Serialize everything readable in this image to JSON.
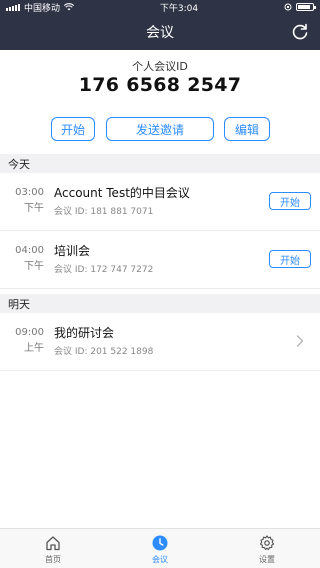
{
  "status_bar": {
    "carrier": "中国移动",
    "time": "下午3:04"
  },
  "nav": {
    "title": "会议",
    "refresh_icon": "refresh-icon"
  },
  "personal_meeting": {
    "label": "个人会议ID",
    "id": "176 6568 2547",
    "start_label": "开始",
    "invite_label": "发送邀请",
    "edit_label": "编辑"
  },
  "sections": [
    {
      "header": "今天",
      "meetings": [
        {
          "time": "03:00",
          "period": "下午",
          "topic": "Account Test的中目会议",
          "meeting_id": "会议 ID: 181 881 7071",
          "action": "开始"
        },
        {
          "time": "04:00",
          "period": "下午",
          "topic": "培训会",
          "meeting_id": "会议 ID: 172 747 7272",
          "action": "开始"
        }
      ]
    },
    {
      "header": "明天",
      "meetings": [
        {
          "time": "09:00",
          "period": "上午",
          "topic": "我的研讨会",
          "meeting_id": "会议 ID: 201 522 1898"
        }
      ]
    }
  ],
  "tabs": [
    {
      "label": "首页",
      "icon": "home-icon"
    },
    {
      "label": "会议",
      "icon": "clock-icon"
    },
    {
      "label": "设置",
      "icon": "gear-icon"
    }
  ],
  "colors": {
    "nav_bg": "#2e3445",
    "accent": "#2d8cff",
    "section_bg": "#f1f1f3"
  }
}
